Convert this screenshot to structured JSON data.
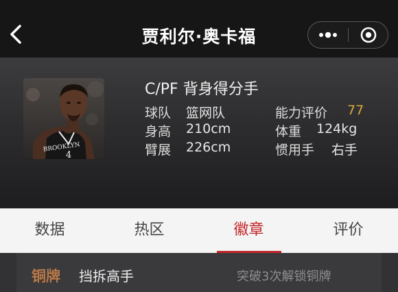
{
  "nav": {
    "title": "贾利尔·奥卡福",
    "back_icon": "chevron-left-icon",
    "more_icon": "more-dots-icon",
    "close_icon": "target-close-icon"
  },
  "player": {
    "position_role": "C/PF 背身得分手",
    "team_label": "球队",
    "team_value": "篮网队",
    "rating_label": "能力评价",
    "rating_value": "77",
    "height_label": "身高",
    "height_value": "210cm",
    "weight_label": "体重",
    "weight_value": "124kg",
    "wingspan_label": "臂展",
    "wingspan_value": "226cm",
    "hand_label": "惯用手",
    "hand_value": "右手",
    "jersey_text": "BROOKLYN",
    "jersey_number": "4"
  },
  "tabs": [
    {
      "label": "数据",
      "active": false
    },
    {
      "label": "热区",
      "active": false
    },
    {
      "label": "徽章",
      "active": true
    },
    {
      "label": "评价",
      "active": false
    }
  ],
  "badges": [
    {
      "tier": "铜牌",
      "name": "挡拆高手",
      "unlock": "突破3次解锁铜牌"
    }
  ],
  "colors": {
    "accent_red": "#c4272b",
    "rating_gold": "#d9a93b",
    "bronze": "#b87848"
  }
}
